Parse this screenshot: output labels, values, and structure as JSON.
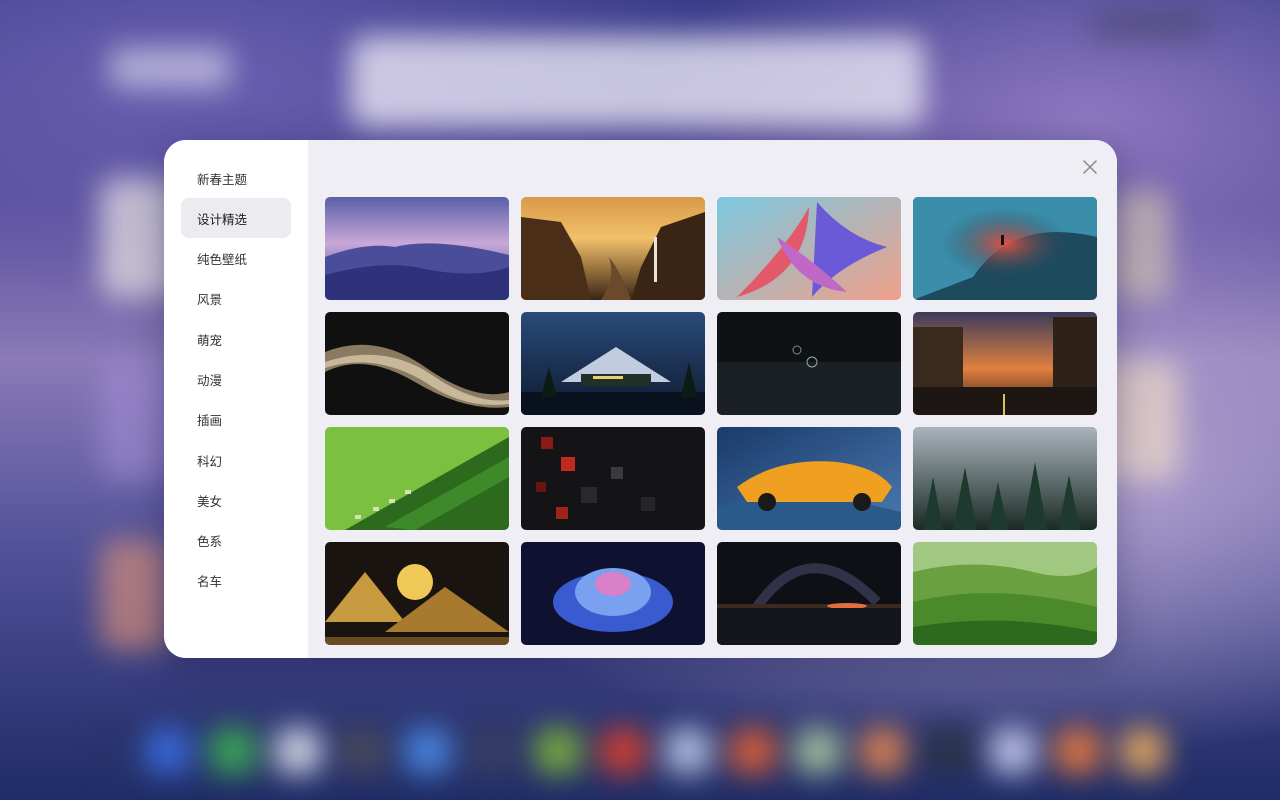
{
  "sidebar": {
    "categories": [
      {
        "label": "新春主题"
      },
      {
        "label": "设计精选"
      },
      {
        "label": "纯色壁纸"
      },
      {
        "label": "风景"
      },
      {
        "label": "萌宠"
      },
      {
        "label": "动漫"
      },
      {
        "label": "插画"
      },
      {
        "label": "科幻"
      },
      {
        "label": "美女"
      },
      {
        "label": "色系"
      },
      {
        "label": "名车"
      }
    ],
    "active_index": 1
  },
  "close_button": {
    "icon": "close-icon"
  },
  "wallpapers": [
    {
      "name": "purple-sand-dunes"
    },
    {
      "name": "canyon-waterfall-sunset"
    },
    {
      "name": "abstract-colorful-petals"
    },
    {
      "name": "blue-curve-figure"
    },
    {
      "name": "dark-silk-wave"
    },
    {
      "name": "mountain-night-store"
    },
    {
      "name": "dark-space-orbs"
    },
    {
      "name": "city-street-dusk"
    },
    {
      "name": "green-hill-cars"
    },
    {
      "name": "red-dark-cubes"
    },
    {
      "name": "orange-supercar"
    },
    {
      "name": "misty-pine-forest"
    },
    {
      "name": "golden-mountain-moon"
    },
    {
      "name": "blue-lotus-flower"
    },
    {
      "name": "milky-way-lake"
    },
    {
      "name": "green-rolling-hills"
    }
  ],
  "colors": {
    "dialog_bg": "#eeeef4",
    "sidebar_bg": "#ffffff",
    "active_item_bg": "#ebebf0"
  }
}
